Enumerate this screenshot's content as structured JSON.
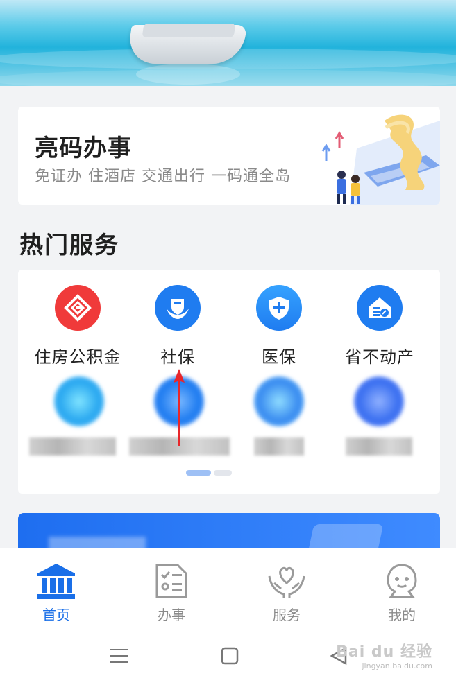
{
  "qr_card": {
    "title": "亮码办事",
    "subtitle": "免证办 住酒店 交通出行 一码通全岛"
  },
  "hot_services": {
    "title": "热门服务",
    "items": [
      {
        "label": "住房公积金",
        "icon": "housing-fund-icon",
        "color": "#f03a3a"
      },
      {
        "label": "社保",
        "icon": "social-security-icon",
        "color": "#1f7cf0"
      },
      {
        "label": "医保",
        "icon": "medical-insurance-shield-icon",
        "color": "#1f8cf5"
      },
      {
        "label": "省不动产",
        "icon": "real-estate-house-icon",
        "color": "#1f7cf0"
      }
    ]
  },
  "tabs": [
    {
      "label": "首页",
      "icon": "home-bank-icon",
      "active": true
    },
    {
      "label": "办事",
      "icon": "checklist-icon",
      "active": false
    },
    {
      "label": "服务",
      "icon": "heart-hands-icon",
      "active": false
    },
    {
      "label": "我的",
      "icon": "profile-face-icon",
      "active": false
    }
  ],
  "watermark": {
    "brand": "Bai du 经验",
    "url": "jingyan.baidu.com"
  },
  "colors": {
    "accent": "#1a6fe8",
    "page_bg": "#f2f3f5"
  }
}
